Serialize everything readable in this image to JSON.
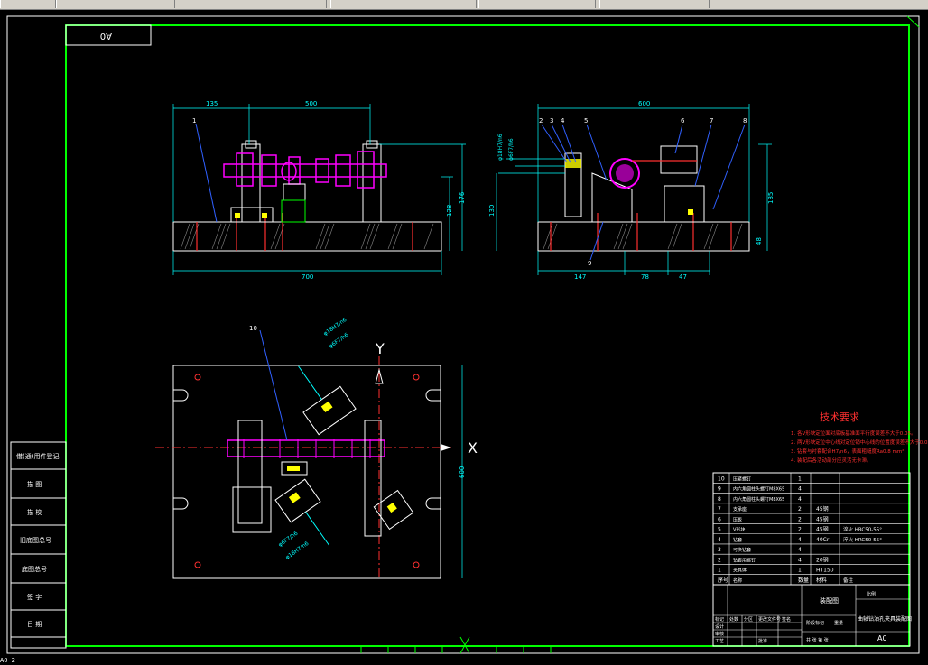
{
  "sheet": {
    "size_label_top": "A0",
    "size_label_bottom": "A0"
  },
  "front_view": {
    "dims": {
      "top_left": "135",
      "top_main": "500",
      "bottom": "700",
      "h1": "128",
      "h2": "176"
    },
    "balloons": [
      "1"
    ]
  },
  "side_view": {
    "dims": {
      "top": "600",
      "left_h": "130",
      "right_h": "185",
      "right_small": "48",
      "b1": "147",
      "b2": "78",
      "b3": "47",
      "fit1": "φ18H7/n6",
      "fit2": "φ6F7/h6"
    },
    "balloons": [
      "2",
      "3",
      "4",
      "5",
      "6",
      "7",
      "8",
      "9"
    ]
  },
  "plan_view": {
    "axis_x": "X",
    "axis_y": "Y",
    "dim_right": "600",
    "balloons": [
      "10"
    ],
    "fit_labels": [
      "φ18H7/n6",
      "φ6F7/h6",
      "φ6F7/h6",
      "φ18H7/n6"
    ]
  },
  "tech_req": {
    "title": "技术要求",
    "lines": [
      "1. 各V形块定位面对底板基准面平行度误差不大于0.05。",
      "2. 两V形块定位中心线对定位销中心线的位置度误差不大于0.02。",
      "3. 钻套与衬套配合H7/n6，表面粗糙度Ra0.8 mm²",
      "4. 装配后各活动部分应灵活无卡滞。"
    ]
  },
  "bom": [
    {
      "no": "10",
      "name": "压紧螺钉",
      "qty": "1",
      "mat": "",
      "note": ""
    },
    {
      "no": "9",
      "name": "内六角圆柱头螺钉M8X65",
      "qty": "4",
      "mat": "",
      "note": ""
    },
    {
      "no": "8",
      "name": "内六角圆柱头螺钉M8X65",
      "qty": "4",
      "mat": "",
      "note": ""
    },
    {
      "no": "7",
      "name": "支承座",
      "qty": "2",
      "mat": "45钢",
      "note": ""
    },
    {
      "no": "6",
      "name": "压板",
      "qty": "2",
      "mat": "45钢",
      "note": ""
    },
    {
      "no": "5",
      "name": "V形块",
      "qty": "2",
      "mat": "45钢",
      "note": "淬火 HRC50-55°"
    },
    {
      "no": "4",
      "name": "钻套",
      "qty": "4",
      "mat": "40Cr",
      "note": "淬火 HRC50-55°"
    },
    {
      "no": "3",
      "name": "可换钻套",
      "qty": "4",
      "mat": "",
      "note": ""
    },
    {
      "no": "2",
      "name": "钻套用螺钉",
      "qty": "4",
      "mat": "20钢",
      "note": ""
    },
    {
      "no": "1",
      "name": "夹具体",
      "qty": "1",
      "mat": "HT150",
      "note": ""
    }
  ],
  "bom_header": {
    "no": "序号",
    "name": "名称",
    "qty": "数量",
    "mat": "材料",
    "note": "备注"
  },
  "title_block": {
    "drawing_name": "曲轴钻油孔夹具装配图",
    "school": "装配图",
    "scale_label": "比例",
    "sheet_code": "A0",
    "cells": [
      "标记",
      "处数",
      "分区",
      "更改文件号",
      "签名",
      "设计",
      "审核",
      "工艺",
      "批准",
      "阶段标记",
      "重量",
      "共 张 第 张"
    ]
  },
  "side_labels": [
    "借(通)用件登记",
    "描 图",
    "描 校",
    "旧底图总号",
    "底图总号",
    "签 字",
    "日 期"
  ],
  "status_text": "A0 2",
  "colors": {
    "frame": "#00ff00",
    "text": "#ffffff",
    "part": "#ff00ff",
    "dim": "#00ffff",
    "req": "#ff3030",
    "yellow": "#ffff00"
  }
}
